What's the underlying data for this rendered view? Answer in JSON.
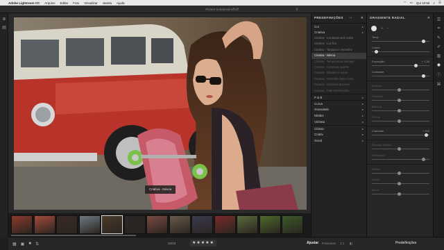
{
  "menubar": {
    "app": "Adobe Lightroom CC",
    "items": [
      "Arquivo",
      "Editar",
      "Foto",
      "Visualizar",
      "Janela",
      "Ajuda"
    ],
    "time": "Qui 10:56"
  },
  "window": {
    "title": "Picture-enhanced-off.tiff"
  },
  "tooltip": "Criativa - Névoa",
  "presets": {
    "title": "PREDEFINIÇÕES",
    "groups_top": [
      {
        "label": "Cor"
      },
      {
        "label": "Criativa"
      }
    ],
    "items": [
      "Criativa - Contraste sem salva",
      "Criativa - Luz fria",
      "Criativa - Tonpura e vermelho",
      "Criativa - Névoa",
      "Criativa - Temperatura average",
      "Criativa - Contraste quente",
      "Criativa - Simples é verde",
      "Criativa - Vermelho fosco forte",
      "Criativa - Sombras quentes",
      "Criativa - Foto envelhecida"
    ],
    "active_index": 3,
    "groups_mid": [
      {
        "label": "P & B"
      },
      {
        "label": "Curva"
      },
      {
        "label": "Granulado"
      },
      {
        "label": "Nitidez"
      },
      {
        "label": "Vinheta"
      }
    ],
    "groups_bottom": [
      {
        "label": "Clássic"
      },
      {
        "label": "Criativ"
      },
      {
        "label": "Geral"
      }
    ]
  },
  "edit_panel": {
    "title": "GRADIENTE RADIAL",
    "sliders": [
      {
        "label": "Temp",
        "value": "",
        "level": 0.95,
        "dim": false
      },
      {
        "label": "Colorir",
        "value": "",
        "level": 0.08,
        "dim": false
      },
      {
        "label": "Exposição",
        "value": "+ 1,36",
        "level": 0.82,
        "dim": false
      },
      {
        "label": "Contraste",
        "value": "",
        "level": 0.95,
        "dim": false
      },
      {
        "label": "Realces",
        "value": "",
        "level": 0.5,
        "dim": true
      },
      {
        "label": "Sombras",
        "value": "",
        "level": 0.5,
        "dim": true
      },
      {
        "label": "Brancos",
        "value": "",
        "level": 0.5,
        "dim": true
      },
      {
        "label": "Pretos",
        "value": "",
        "level": 0.5,
        "dim": true
      },
      {
        "label": "Claridade",
        "value": "+ 100",
        "level": 1.0,
        "dim": false
      },
      {
        "label": "Eliminar neblina",
        "value": "",
        "level": 0.5,
        "dim": true
      },
      {
        "label": "Saturação",
        "value": "",
        "level": 0.95,
        "dim": true
      },
      {
        "label": "Nitidez",
        "value": "",
        "level": 0.5,
        "dim": true
      },
      {
        "label": "Ruído",
        "value": "",
        "level": 0.5,
        "dim": true
      },
      {
        "label": "Moiré",
        "value": "",
        "level": 0.5,
        "dim": true
      }
    ]
  },
  "filmstrip": {
    "thumbs": [
      "#8a3a2a",
      "#a44a3a",
      "#3a2a22",
      "#6d7a84",
      "#4a3a2a",
      "#2a2628",
      "#7a4a42",
      "#6a5a4a",
      "#3a3a52",
      "#7a2a2a",
      "#5a6a3a",
      "#4a6a2a",
      "#3a5a2a"
    ],
    "selected_index": 4
  },
  "bottombar": {
    "counter": "25/33",
    "stars": "★★★★★",
    "adjust": "Ajustar",
    "tab_presets_small": "Presentes",
    "tab_ratio": "1:1",
    "presets_tab": "Predefinições"
  }
}
